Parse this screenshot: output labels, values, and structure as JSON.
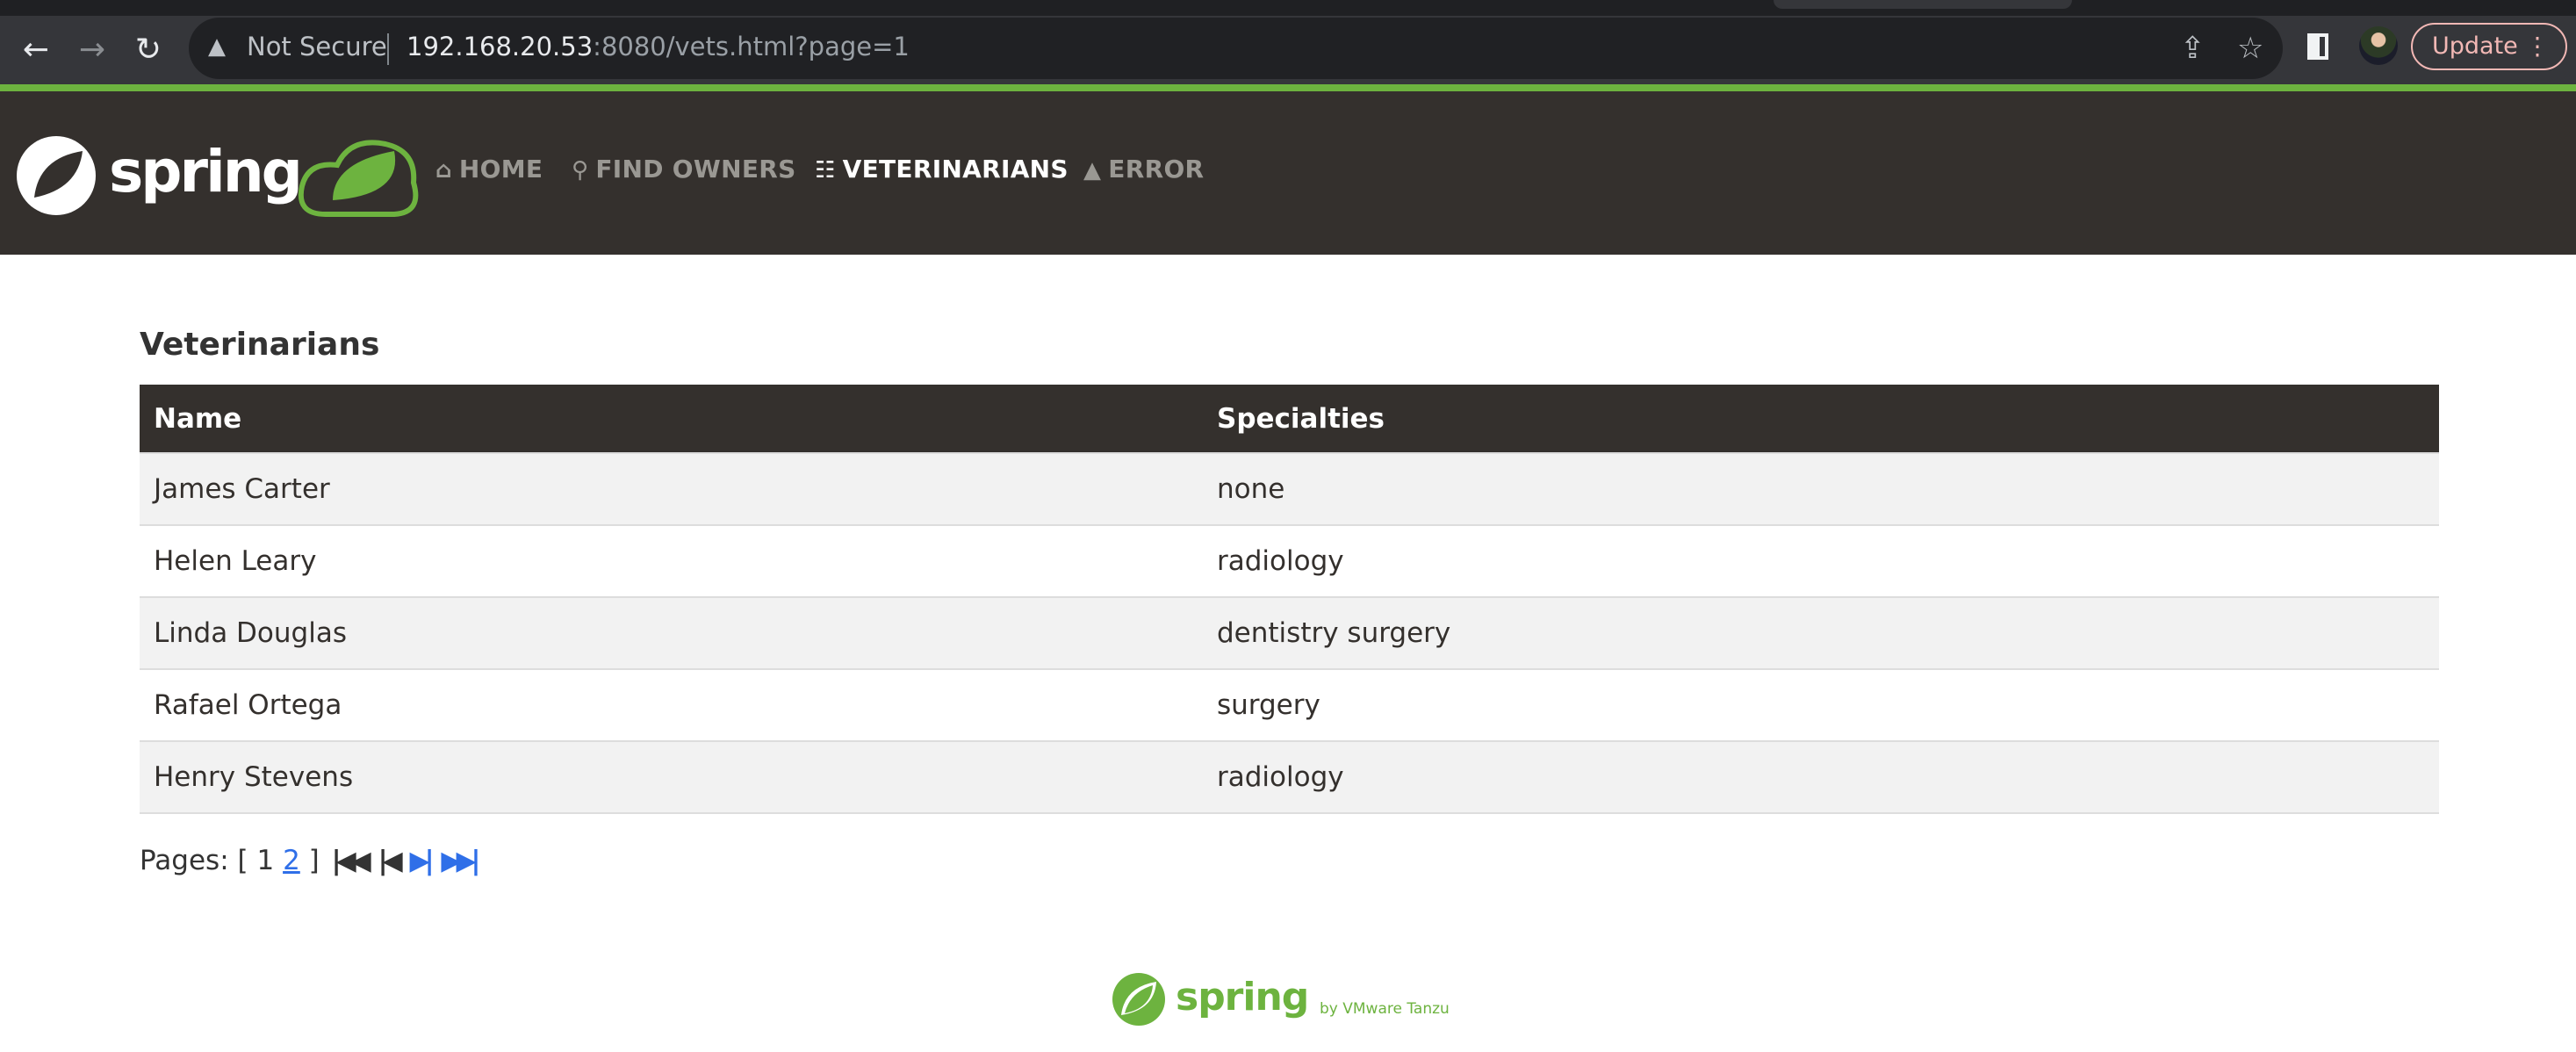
{
  "browser": {
    "security_label": "Not Secure",
    "url_host": "192.168.20.53",
    "url_rest": ":8080/vets.html?page=1",
    "update_label": "Update"
  },
  "navbar": {
    "items": [
      {
        "label": "HOME",
        "icon": "home-icon"
      },
      {
        "label": "FIND OWNERS",
        "icon": "search-icon"
      },
      {
        "label": "VETERINARIANS",
        "icon": "list-icon",
        "active": true
      },
      {
        "label": "ERROR",
        "icon": "warning-icon"
      }
    ]
  },
  "page": {
    "title": "Veterinarians",
    "columns": [
      "Name",
      "Specialties"
    ],
    "rows": [
      {
        "name": "James Carter",
        "specialties": "none"
      },
      {
        "name": "Helen Leary",
        "specialties": "radiology"
      },
      {
        "name": "Linda Douglas",
        "specialties": "dentistry surgery"
      },
      {
        "name": "Rafael Ortega",
        "specialties": "surgery"
      },
      {
        "name": "Henry Stevens",
        "specialties": "radiology"
      }
    ],
    "pagination": {
      "label": "Pages:",
      "open": "[",
      "current": "1",
      "next_page": "2",
      "close": "]"
    }
  },
  "footer": {
    "logo_text": "spring",
    "tagline": "by VMware Tanzu"
  },
  "colors": {
    "brand_green": "#6db33f",
    "navbar": "#34302d",
    "link": "#2f6fe8"
  }
}
